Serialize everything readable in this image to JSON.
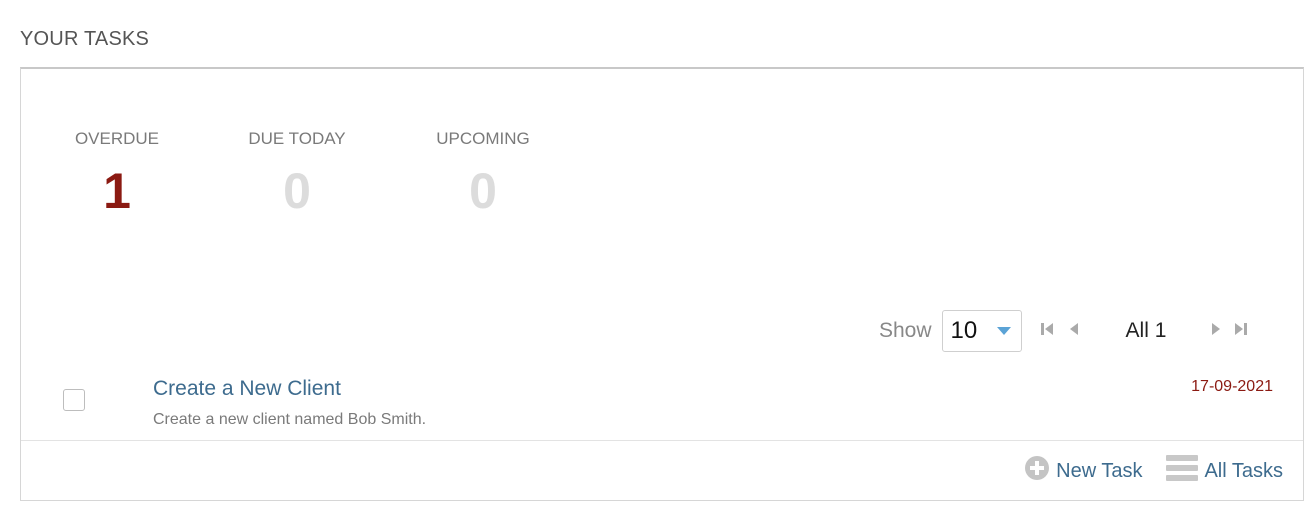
{
  "section": {
    "title": "YOUR TASKS"
  },
  "counters": {
    "overdue": {
      "label": "OVERDUE",
      "value": "1"
    },
    "due_today": {
      "label": "DUE TODAY",
      "value": "0"
    },
    "upcoming": {
      "label": "UPCOMING",
      "value": "0"
    }
  },
  "pager": {
    "show_label": "Show",
    "page_size": "10",
    "page_info": "All 1"
  },
  "tasks": [
    {
      "title": "Create a New Client",
      "description": "Create a new client named Bob Smith.",
      "date": "17-09-2021"
    }
  ],
  "footer": {
    "new_task": "New Task",
    "all_tasks": "All Tasks"
  },
  "colors": {
    "overdue": "#8b1a12",
    "link": "#3d6b8e",
    "muted_number": "#dcdcdc",
    "caret": "#5ba3d6"
  }
}
